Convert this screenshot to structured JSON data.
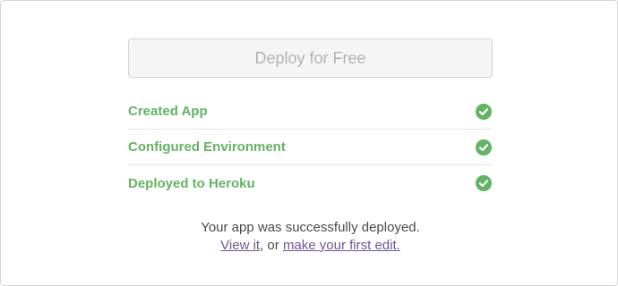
{
  "deploy": {
    "button_label": "Deploy for Free"
  },
  "steps": [
    {
      "label": "Created App",
      "status_icon": "check-circle-icon"
    },
    {
      "label": "Configured Environment",
      "status_icon": "check-circle-icon"
    },
    {
      "label": "Deployed to Heroku",
      "status_icon": "check-circle-icon"
    }
  ],
  "result": {
    "message": "Your app was successfully deployed.",
    "view_link": "View it",
    "separator": ", or ",
    "edit_link": "make your first edit."
  },
  "colors": {
    "success": "#62b462",
    "link": "#6f5499",
    "text": "#4a4a4a",
    "disabled_text": "#b3b3b3"
  }
}
